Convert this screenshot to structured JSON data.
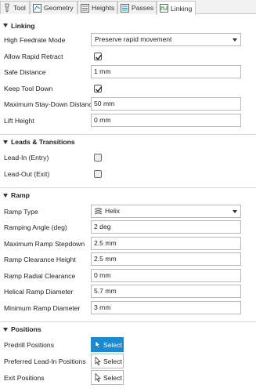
{
  "tabs": [
    {
      "label": "Tool",
      "icon": "tool-icon"
    },
    {
      "label": "Geometry",
      "icon": "geometry-icon"
    },
    {
      "label": "Heights",
      "icon": "heights-icon"
    },
    {
      "label": "Passes",
      "icon": "passes-icon"
    },
    {
      "label": "Linking",
      "icon": "linking-icon",
      "active": true
    }
  ],
  "sections": {
    "linking": {
      "title": "Linking",
      "high_feedrate_mode": {
        "label": "High Feedrate Mode",
        "value": "Preserve rapid movement"
      },
      "allow_rapid_retract": {
        "label": "Allow Rapid Retract",
        "checked": true
      },
      "safe_distance": {
        "label": "Safe Distance",
        "value": "1 mm"
      },
      "keep_tool_down": {
        "label": "Keep Tool Down",
        "checked": true
      },
      "max_stay_down_distance": {
        "label": "Maximum Stay-Down Distance",
        "value": "50 mm"
      },
      "lift_height": {
        "label": "Lift Height",
        "value": "0 mm"
      }
    },
    "leads": {
      "title": "Leads & Transitions",
      "lead_in": {
        "label": "Lead-In (Entry)",
        "checked": false
      },
      "lead_out": {
        "label": "Lead-Out (Exit)",
        "checked": false
      }
    },
    "ramp": {
      "title": "Ramp",
      "ramp_type": {
        "label": "Ramp Type",
        "value": "Helix",
        "icon": "helix-icon"
      },
      "ramping_angle": {
        "label": "Ramping Angle (deg)",
        "value": "2 deg"
      },
      "max_ramp_stepdown": {
        "label": "Maximum Ramp Stepdown",
        "value": "2.5 mm"
      },
      "ramp_clearance_height": {
        "label": "Ramp Clearance Height",
        "value": "2.5 mm"
      },
      "ramp_radial_clearance": {
        "label": "Ramp Radial Clearance",
        "value": "0 mm"
      },
      "helical_ramp_diameter": {
        "label": "Helical Ramp Diameter",
        "value": "5.7 mm"
      },
      "min_ramp_diameter": {
        "label": "Minimum Ramp Diameter",
        "value": "3 mm"
      }
    },
    "positions": {
      "title": "Positions",
      "predrill": {
        "label": "Predrill Positions",
        "button": "Select",
        "active": true
      },
      "preferred_lead_in": {
        "label": "Preferred Lead-In Positions",
        "button": "Select",
        "active": false
      },
      "exit": {
        "label": "Exit Positions",
        "button": "Select",
        "active": false
      }
    }
  },
  "colors": {
    "accent": "#1a8ad2",
    "background": "#ffffff",
    "tabbar": "#f2f2f2",
    "border": "#b8b8b8"
  }
}
